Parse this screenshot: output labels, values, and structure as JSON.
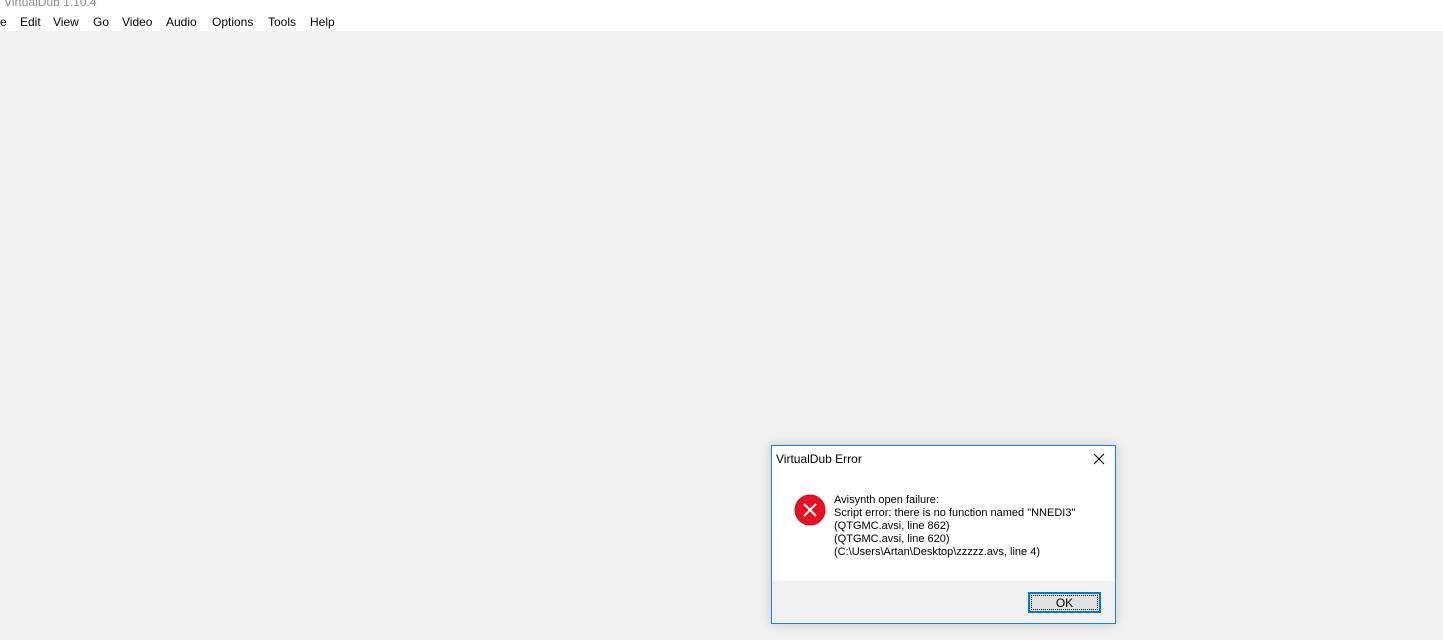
{
  "window": {
    "title": "VirtualDub 1.10.4"
  },
  "menubar": {
    "items": [
      {
        "label": "e"
      },
      {
        "label": "Edit"
      },
      {
        "label": "View"
      },
      {
        "label": "Go"
      },
      {
        "label": "Video"
      },
      {
        "label": "Audio"
      },
      {
        "label": "Options"
      },
      {
        "label": "Tools"
      },
      {
        "label": "Help"
      }
    ]
  },
  "dialog": {
    "title": "VirtualDub Error",
    "icon": "error-icon",
    "close_icon": "close-icon",
    "message_lines": [
      "Avisynth open failure:",
      "Script error: there is no function named \"NNEDI3\"",
      "(QTGMC.avsi, line 862)",
      "(QTGMC.avsi, line 620)",
      "(C:\\Users\\Artan\\Desktop\\zzzzz.avs, line 4)"
    ],
    "ok_label": "OK"
  },
  "colors": {
    "accent": "#0078d7",
    "dialog_border": "#1883d7",
    "error_red": "#e81123",
    "workspace_bg": "#f0f0f0"
  }
}
